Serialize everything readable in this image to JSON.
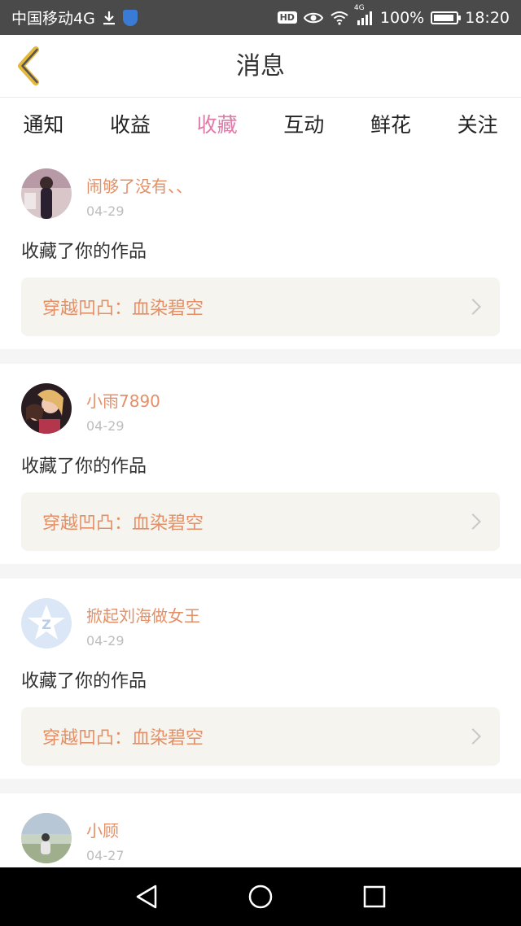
{
  "status_bar": {
    "carrier": "中国移动4G",
    "hd": "HD",
    "network": "4G",
    "battery": "100%",
    "time": "18:20"
  },
  "header": {
    "title": "消息"
  },
  "tabs": [
    {
      "label": "通知"
    },
    {
      "label": "收益"
    },
    {
      "label": "收藏",
      "active": true
    },
    {
      "label": "互动"
    },
    {
      "label": "鲜花"
    },
    {
      "label": "关注"
    }
  ],
  "messages": [
    {
      "username": "闹够了没有、、",
      "date": "04-29",
      "action": "收藏了你的作品",
      "work_title": "穿越凹凸：血染碧空"
    },
    {
      "username": "小雨7890",
      "date": "04-29",
      "action": "收藏了你的作品",
      "work_title": "穿越凹凸：血染碧空"
    },
    {
      "username": "掀起刘海做女王",
      "date": "04-29",
      "action": "收藏了你的作品",
      "work_title": "穿越凹凸：血染碧空"
    },
    {
      "username": "小顾",
      "date": "04-27"
    }
  ],
  "colors": {
    "accent_pink": "#e07aa9",
    "accent_orange": "#e39068",
    "statusbar": "#4a4a4a"
  }
}
